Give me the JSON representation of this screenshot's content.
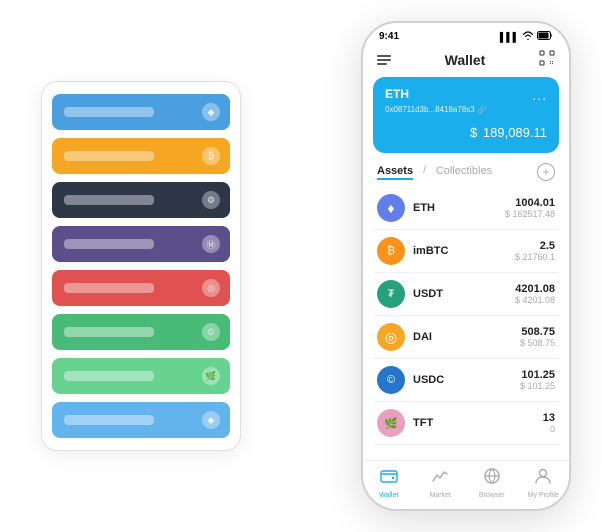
{
  "app": {
    "title": "Wallet"
  },
  "status_bar": {
    "time": "9:41",
    "signal": "▌▌▌",
    "wifi": "WiFi",
    "battery": "🔋"
  },
  "header": {
    "title": "Wallet"
  },
  "eth_card": {
    "label": "ETH",
    "address": "0x08711d3b...8418a78s3",
    "address_suffix": "🔗",
    "dots": "...",
    "currency": "$",
    "amount": "189,089.11"
  },
  "assets_section": {
    "tab_active": "Assets",
    "divider": "/",
    "tab_inactive": "Collectibles",
    "add_label": "+"
  },
  "assets": [
    {
      "name": "ETH",
      "icon": "♦",
      "icon_bg": "#627EEA",
      "amount": "1004.01",
      "usd": "$ 162517.48"
    },
    {
      "name": "imBTC",
      "icon": "₿",
      "icon_bg": "#F7931A",
      "amount": "2.5",
      "usd": "$ 21760.1"
    },
    {
      "name": "USDT",
      "icon": "₮",
      "icon_bg": "#26A17B",
      "amount": "4201.08",
      "usd": "$ 4201.08"
    },
    {
      "name": "DAI",
      "icon": "◎",
      "icon_bg": "#F5A623",
      "amount": "508.75",
      "usd": "$ 508.75"
    },
    {
      "name": "USDC",
      "icon": "©",
      "icon_bg": "#2775CA",
      "amount": "101.25",
      "usd": "$ 101.25"
    },
    {
      "name": "TFT",
      "icon": "🌿",
      "icon_bg": "#E8A0BF",
      "amount": "13",
      "usd": "0"
    }
  ],
  "bottom_nav": [
    {
      "label": "Wallet",
      "active": true,
      "icon": "⊙"
    },
    {
      "label": "Market",
      "active": false,
      "icon": "📈"
    },
    {
      "label": "Browser",
      "active": false,
      "icon": "👤"
    },
    {
      "label": "My Profile",
      "active": false,
      "icon": "👤"
    }
  ],
  "card_stack": {
    "colors": [
      "#4A9FE0",
      "#F5A623",
      "#2D3748",
      "#5A4F8A",
      "#E05252",
      "#48BB78",
      "#68D391",
      "#63B3ED"
    ]
  }
}
